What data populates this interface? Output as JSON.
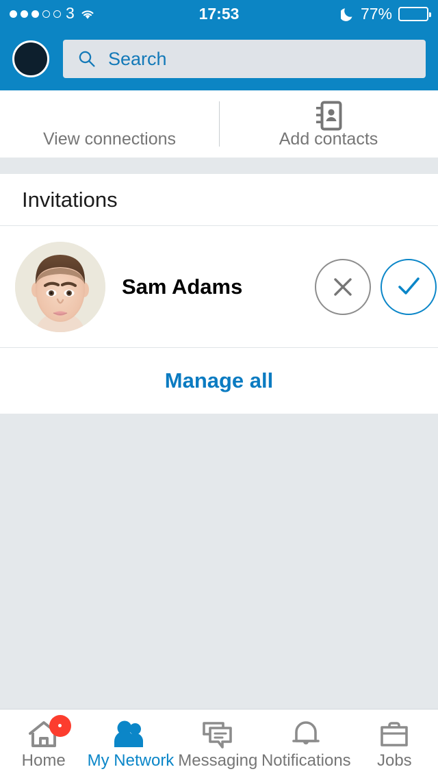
{
  "status_bar": {
    "signal_dots_total": 5,
    "signal_dots_filled": 3,
    "carrier": "3",
    "wifi_icon": "wifi-icon",
    "time": "17:53",
    "dnd_icon": "moon-icon",
    "battery_percent": "77%",
    "battery_level": 77
  },
  "header": {
    "avatar_name": "profile-avatar",
    "search": {
      "icon": "search-icon",
      "placeholder": "Search",
      "value": ""
    }
  },
  "action_tabs": [
    {
      "label": "View connections",
      "icon": ""
    },
    {
      "label": "Add contacts",
      "icon": "contacts-book-icon"
    }
  ],
  "invitations": {
    "title": "Invitations",
    "items": [
      {
        "name": "Sam Adams",
        "avatar": "person-photo",
        "decline_icon": "close-icon",
        "accept_icon": "check-icon"
      }
    ],
    "manage_all_label": "Manage all"
  },
  "bottom_nav": {
    "active_index": 1,
    "items": [
      {
        "label": "Home",
        "icon": "home-icon",
        "badge": true
      },
      {
        "label": "My Network",
        "icon": "people-icon",
        "badge": false
      },
      {
        "label": "Messaging",
        "icon": "chat-bubbles-icon",
        "badge": false
      },
      {
        "label": "Notifications",
        "icon": "bell-icon",
        "badge": false
      },
      {
        "label": "Jobs",
        "icon": "briefcase-icon",
        "badge": false
      }
    ]
  },
  "colors": {
    "brand_blue": "#0c85c4",
    "link_blue": "#0b7bc1",
    "accent_blue": "#0b86c8",
    "page_gray": "#e4e8eb",
    "text_gray": "#767676",
    "badge_red": "#fc3d2e",
    "card_white": "#ffffff"
  }
}
